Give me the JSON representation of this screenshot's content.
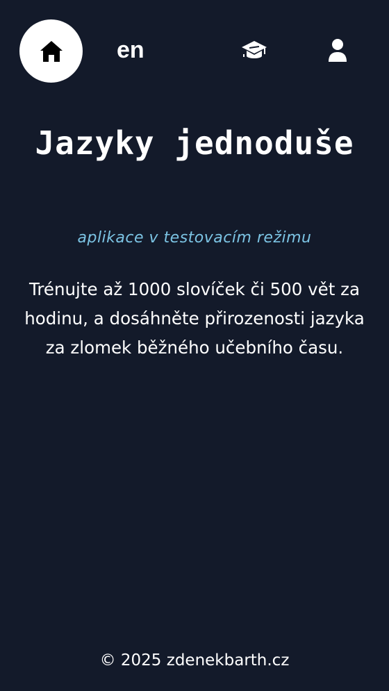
{
  "nav": {
    "home_icon": "home-icon",
    "language": "en",
    "courses_icon": "graduation-cap-icon",
    "profile_icon": "user-icon"
  },
  "hero": {
    "title": "Jazyky jednoduše",
    "subtitle": "aplikace v testovacím režimu",
    "description": "Trénujte až 1000 slovíček či 500 vět za hodinu, a dosáhněte přirozenosti jazyka za zlomek běžného učebního času."
  },
  "footer": {
    "copyright": "© 2025 zdenekbarth.cz"
  },
  "colors": {
    "background": "#131a2a",
    "accent": "#7cc4e4",
    "text": "#ffffff"
  }
}
